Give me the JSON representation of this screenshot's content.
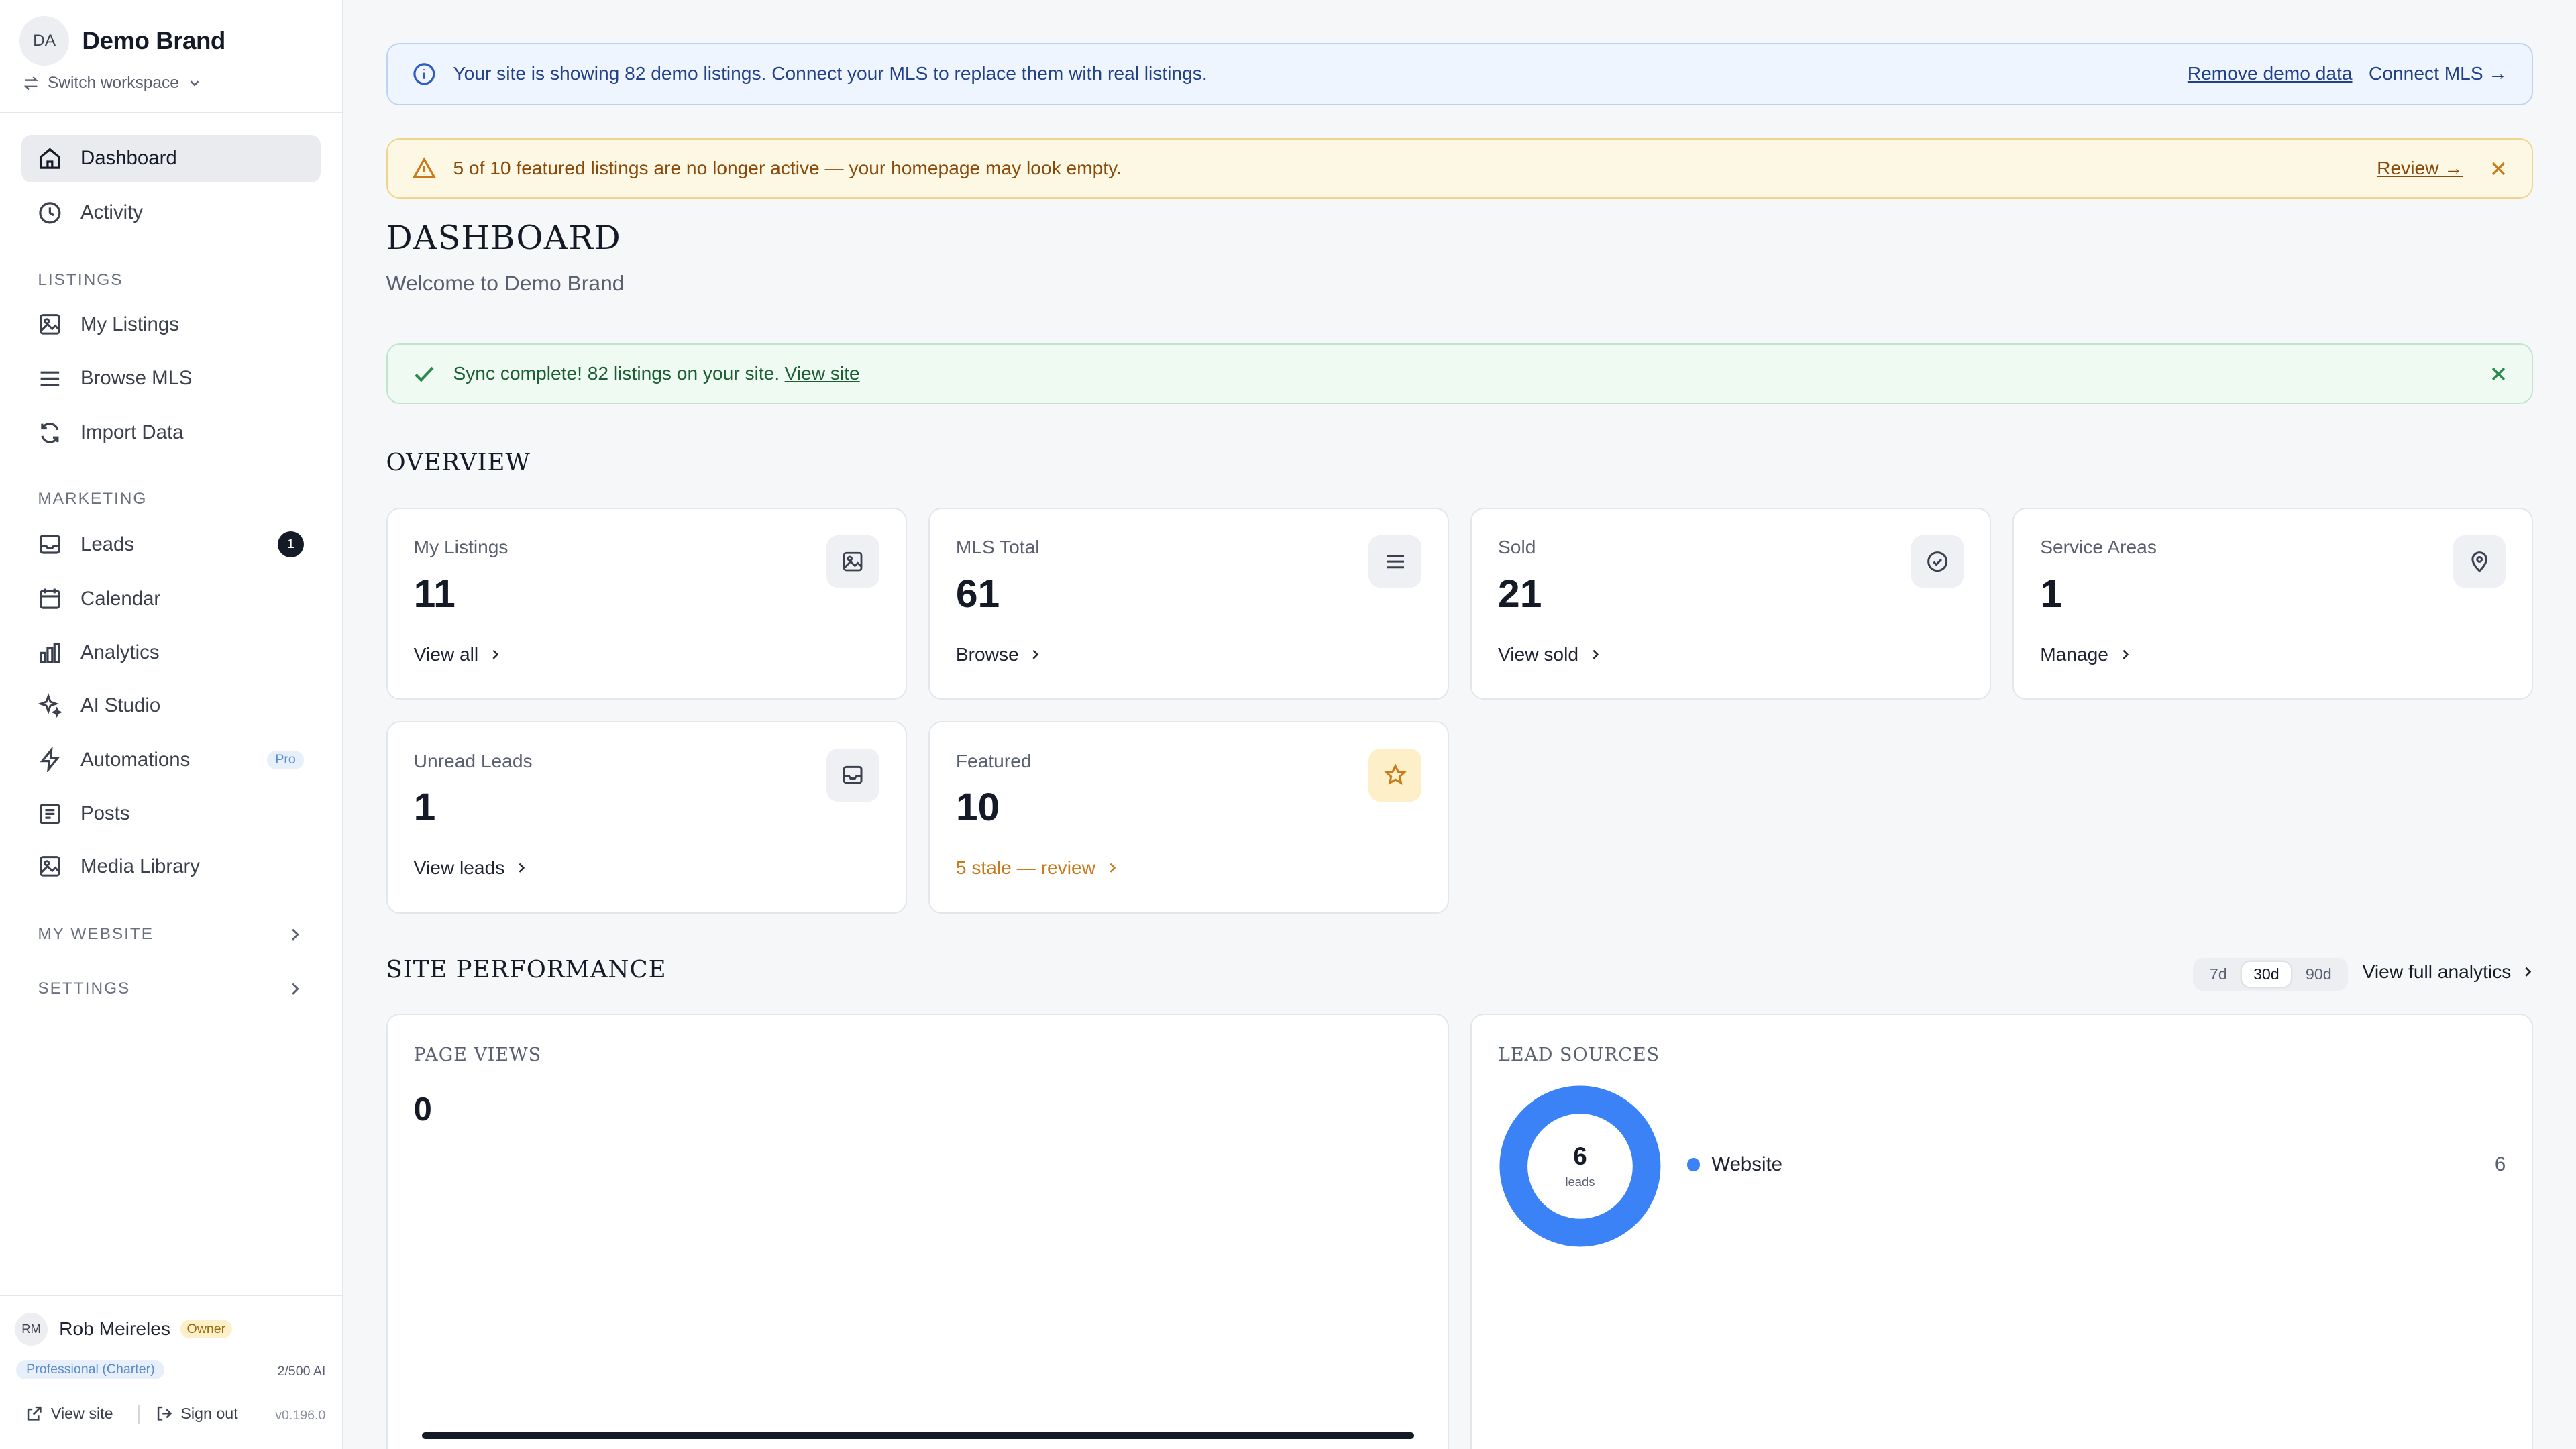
{
  "workspace": {
    "avatar_initials": "DA",
    "brand_name": "Demo Brand",
    "switch_label": "Switch workspace"
  },
  "nav": {
    "dashboard": "Dashboard",
    "activity": "Activity",
    "listings_section": "LISTINGS",
    "my_listings": "My Listings",
    "browse_mls": "Browse MLS",
    "import_data": "Import Data",
    "marketing_section": "MARKETING",
    "leads": "Leads",
    "leads_badge": "1",
    "calendar": "Calendar",
    "analytics": "Analytics",
    "ai_studio": "AI Studio",
    "automations": "Automations",
    "automations_badge": "Pro",
    "posts": "Posts",
    "media_library": "Media Library",
    "my_website_section": "MY WEBSITE",
    "settings_section": "SETTINGS"
  },
  "user": {
    "initials": "RM",
    "name": "Rob Meireles",
    "role": "Owner",
    "plan": "Professional (Charter)",
    "ai_usage": "2/500 AI",
    "view_site": "View site",
    "sign_out": "Sign out",
    "version": "v0.196.0"
  },
  "banners": {
    "info_text": "Your site is showing 82 demo listings. Connect your MLS to replace them with real listings.",
    "info_remove": "Remove demo data",
    "info_connect": "Connect MLS →",
    "warn_text": "5 of 10 featured listings are no longer active — your homepage may look empty.",
    "warn_review": "Review →",
    "sync_text": "Sync complete! 82 listings on your site.",
    "sync_link": "View site"
  },
  "page": {
    "title": "DASHBOARD",
    "subtitle": "Welcome to Demo Brand",
    "overview_heading": "OVERVIEW",
    "performance_heading": "SITE PERFORMANCE"
  },
  "stats": [
    {
      "label": "My Listings",
      "value": "11",
      "link": "View all",
      "icon": "image-icon"
    },
    {
      "label": "MLS Total",
      "value": "61",
      "link": "Browse",
      "icon": "list-icon"
    },
    {
      "label": "Sold",
      "value": "21",
      "link": "View sold",
      "icon": "check-circle-icon"
    },
    {
      "label": "Service Areas",
      "value": "1",
      "link": "Manage",
      "icon": "map-pin-icon"
    },
    {
      "label": "Unread Leads",
      "value": "1",
      "link": "View leads",
      "icon": "inbox-icon"
    },
    {
      "label": "Featured",
      "value": "10",
      "link": "5 stale — review",
      "icon": "star-icon"
    }
  ],
  "performance": {
    "ranges": [
      "7d",
      "30d",
      "90d"
    ],
    "selected_range": "30d",
    "full_analytics": "View full analytics"
  },
  "page_views": {
    "title": "PAGE VIEWS",
    "value": "0"
  },
  "lead_sources": {
    "title": "LEAD SOURCES",
    "total": "6",
    "total_label": "leads",
    "items": [
      {
        "label": "Website",
        "count": "6",
        "color": "#3b82f6"
      }
    ]
  },
  "colors": {
    "accent_blue": "#3b82f6",
    "warning": "#c97a1a",
    "success": "#1d5f34",
    "dark": "#141a26"
  }
}
